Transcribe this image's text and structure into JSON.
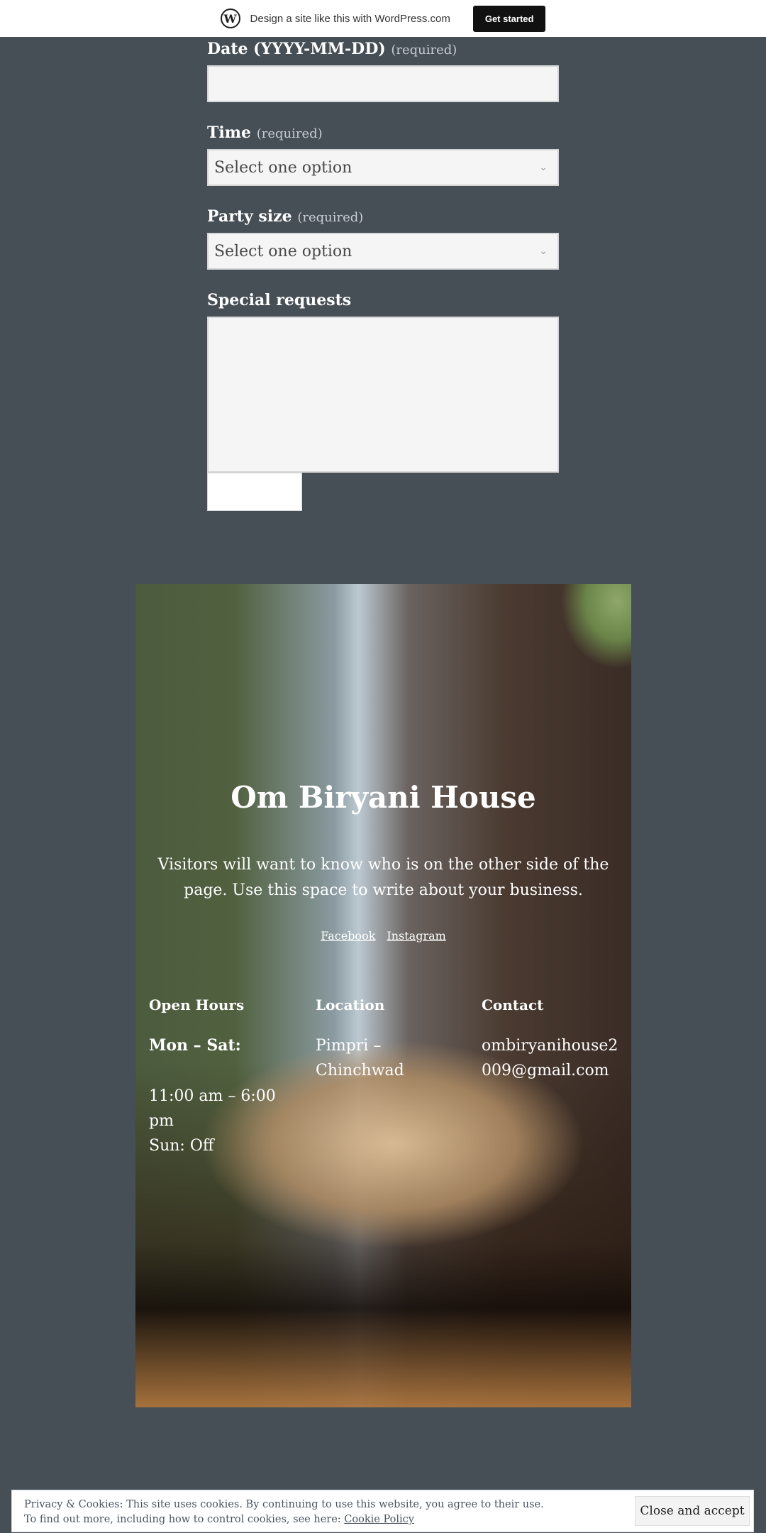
{
  "wp_banner": {
    "logo": "wordpress-logo",
    "text": "Design a site like this with WordPress.com",
    "button_label": "Get started"
  },
  "form": {
    "date": {
      "label": "Date (YYYY-MM-DD)",
      "required": "(required)",
      "value": ""
    },
    "time": {
      "label": "Time",
      "required": "(required)",
      "selected": "Select one option"
    },
    "party_size": {
      "label": "Party size",
      "required": "(required)",
      "selected": "Select one option"
    },
    "special_requests": {
      "label": "Special requests",
      "value": ""
    },
    "submit_label": ""
  },
  "hero": {
    "title": "Om Biryani House",
    "description": "Visitors will want to know who is on the other side of the page. Use this space to write about your business.",
    "links": [
      "Facebook",
      "Instagram"
    ]
  },
  "info": {
    "hours": {
      "title": "Open Hours",
      "days": "Mon – Sat:",
      "time": "11:00 am – 6:00 pm",
      "sunday": "Sun: Off"
    },
    "location": {
      "title": "Location",
      "value": "Pimpri – Chinchwad"
    },
    "contact": {
      "title": "Contact",
      "email_line1": "ombiryanihouse2",
      "email_line2": "009@gmail.com"
    }
  },
  "cookie": {
    "line1": "Privacy & Cookies: This site uses cookies. By continuing to use this website, you agree to their use.",
    "line2": "To find out more, including how to control cookies, see here:",
    "link": "Cookie Policy",
    "button_label": "Close and accept"
  },
  "colors": {
    "page_bg": "#464e56",
    "banner_bg": "#ffffff",
    "button_dark": "#111111"
  }
}
